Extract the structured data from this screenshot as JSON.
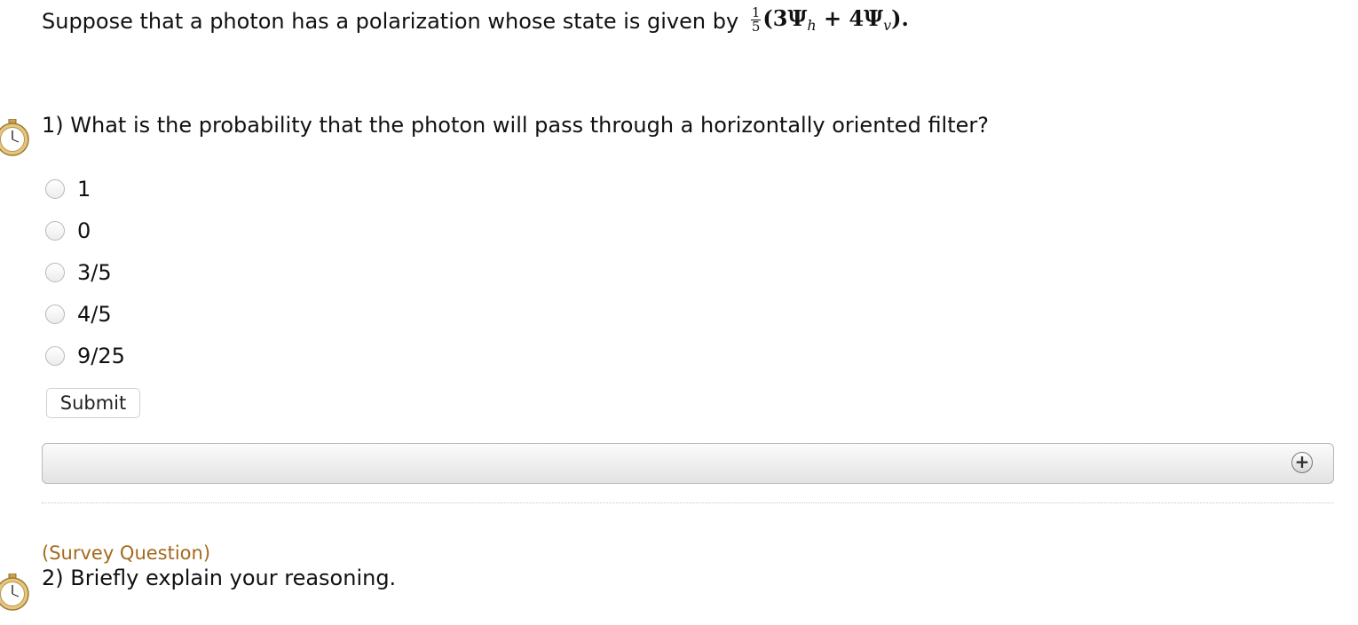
{
  "intro": {
    "text": "Suppose that a photon has a polarization whose state is given by",
    "math": {
      "numerator": "1",
      "denominator": "5",
      "open": "(3Ψ",
      "sub_h": "h",
      "middle": " + 4Ψ",
      "sub_v": "v",
      "close": ")."
    }
  },
  "question1": {
    "text": "1) What is the probability that the photon will pass through a horizontally oriented filter?",
    "options": [
      "1",
      "0",
      "3/5",
      "4/5",
      "9/25"
    ],
    "submit_label": "Submit"
  },
  "question2": {
    "survey_label": "(Survey Question)",
    "text": "2) Briefly explain your reasoning."
  },
  "icons": {
    "timer": "stopwatch-icon",
    "expand": "plus-icon"
  },
  "colors": {
    "survey_label": "#a46a1c",
    "timer_gold": "#d9b46a"
  }
}
